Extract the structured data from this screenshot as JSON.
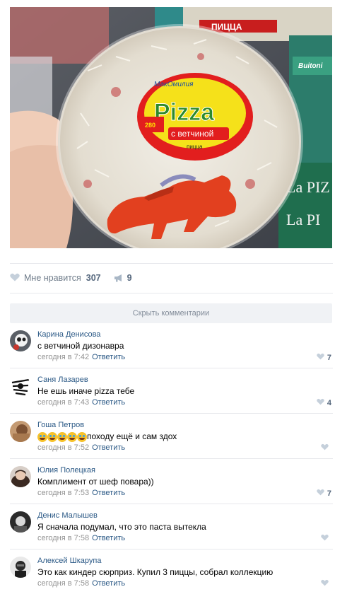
{
  "post": {
    "photo": {
      "label_brand": "Pizza",
      "label_variant": "с ветчиной",
      "label_small": "пицца",
      "label_logo": "МакОмилия",
      "label_price": "280",
      "box_top_text": "ПИЦЦА",
      "box_right_lines": [
        "La PIZ",
        "La PI"
      ],
      "box_small_brand": "Buitoni"
    },
    "actions": {
      "like_label": "Мне нравится",
      "like_count": "307",
      "share_count": "9"
    },
    "hide_comments_label": "Скрыть комментарии"
  },
  "comments": [
    {
      "author": "Карина Денисова",
      "text": "с ветчиной дизонавра",
      "time": "сегодня в 7:42",
      "reply": "Ответить",
      "likes": "7"
    },
    {
      "author": "Саня Лазарев",
      "text": "Не ешь иначе pizza тебе",
      "time": "сегодня в 7:43",
      "reply": "Ответить",
      "likes": "4"
    },
    {
      "author": "Гоша Петров",
      "text": "походу ещё и сам здох",
      "emoji_count": 5,
      "time": "сегодня в 7:52",
      "reply": "Ответить",
      "likes": ""
    },
    {
      "author": "Юлия Полецкая",
      "text": "Комплимент от шеф повара))",
      "time": "сегодня в 7:53",
      "reply": "Ответить",
      "likes": "7"
    },
    {
      "author": "Денис Малышев",
      "text": "Я сначала подумал, что это паста вытекла",
      "time": "сегодня в 7:58",
      "reply": "Ответить",
      "likes": ""
    },
    {
      "author": "Алексей Шкарупа",
      "text": "Это как киндер сюрприз. Купил 3 пиццы, собрал коллекцию",
      "time": "сегодня в 7:58",
      "reply": "Ответить",
      "likes": ""
    }
  ],
  "colors": {
    "link": "#2a5885",
    "meta": "#939393",
    "separator": "#e7e8ec",
    "hide_bg": "#f0f2f5"
  },
  "icons": {
    "like": "heart-icon",
    "share": "megaphone-icon",
    "emoji": "tears-of-joy-emoji"
  }
}
